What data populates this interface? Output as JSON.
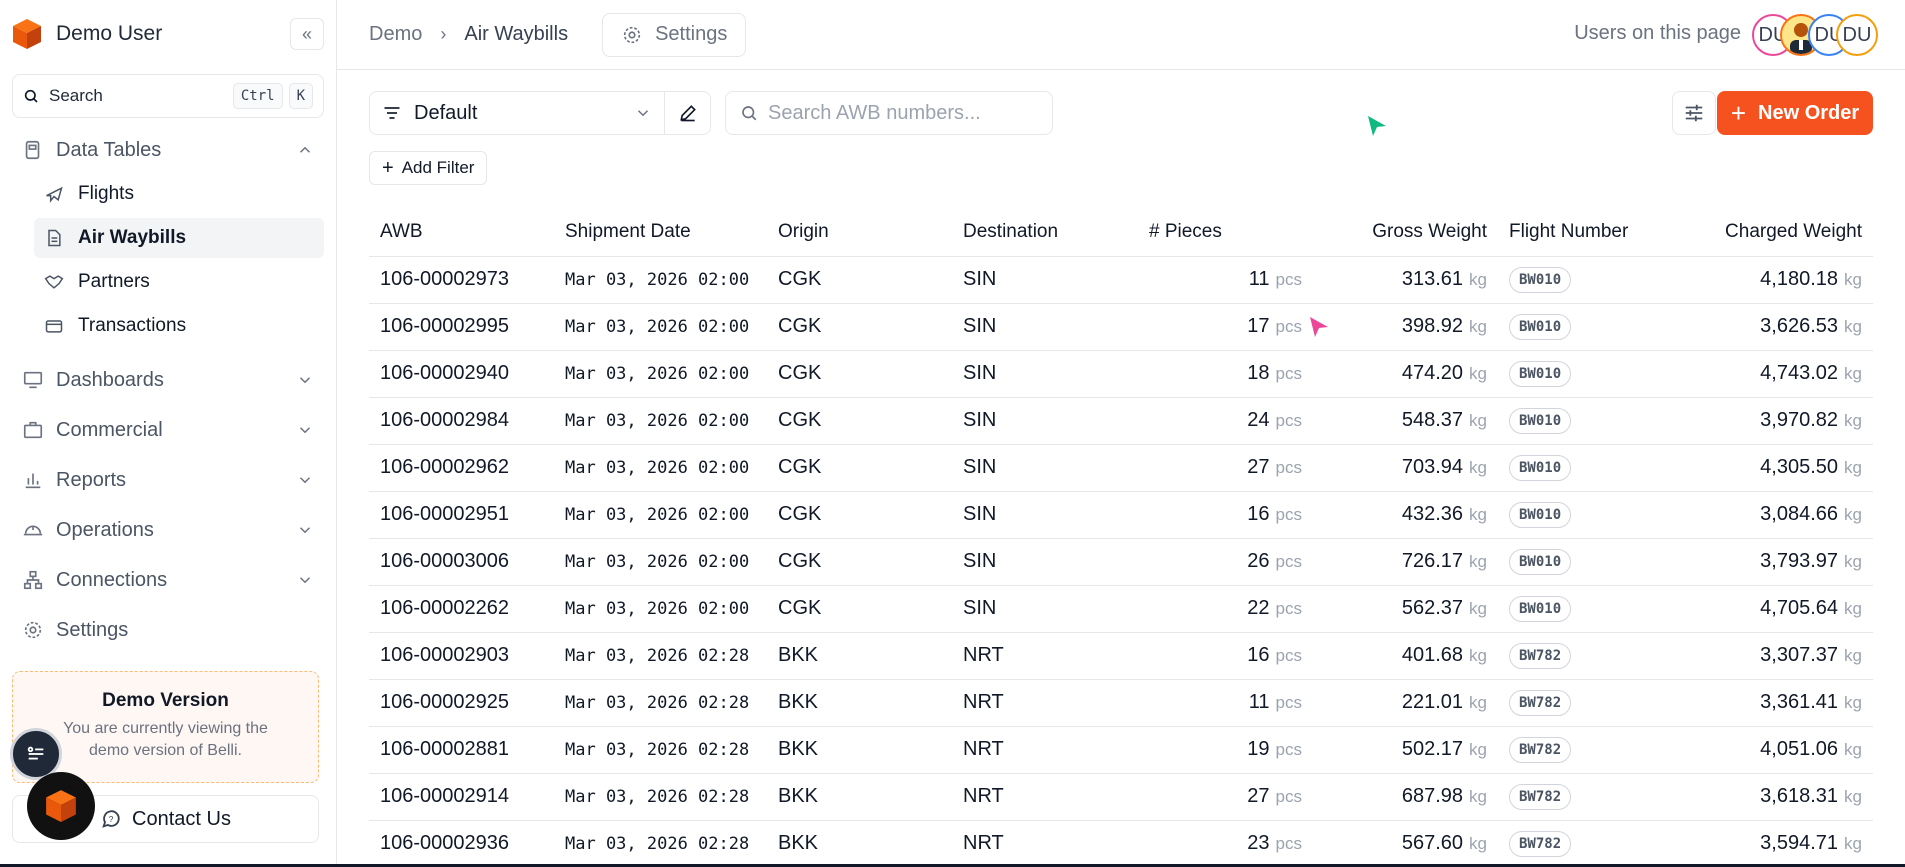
{
  "sidebar": {
    "user_name": "Demo User",
    "search_label": "Search",
    "kbd_ctrl": "Ctrl",
    "kbd_k": "K",
    "data_tables_label": "Data Tables",
    "sub_items": [
      {
        "label": "Flights",
        "icon": "plane-icon"
      },
      {
        "label": "Air Waybills",
        "icon": "document-icon",
        "active": true
      },
      {
        "label": "Partners",
        "icon": "handshake-icon"
      },
      {
        "label": "Transactions",
        "icon": "card-icon"
      }
    ],
    "groups": [
      {
        "label": "Dashboards",
        "icon": "monitor-icon"
      },
      {
        "label": "Commercial",
        "icon": "briefcase-icon"
      },
      {
        "label": "Reports",
        "icon": "bar-chart-icon"
      },
      {
        "label": "Operations",
        "icon": "hardhat-icon"
      },
      {
        "label": "Connections",
        "icon": "network-icon"
      }
    ],
    "settings_label": "Settings",
    "demo_card": {
      "title": "Demo Version",
      "line1": "You are currently viewing the",
      "line2": "demo version of Belli."
    },
    "contact_label": "Contact Us"
  },
  "header": {
    "crumb_root": "Demo",
    "crumb_current": "Air Waybills",
    "settings_label": "Settings",
    "users_label": "Users on this page",
    "avatars": [
      {
        "initials": "DU",
        "color": "#ec4899"
      },
      {
        "initials": "",
        "color": "#f97316"
      },
      {
        "initials": "DU",
        "color": "#3b82f6"
      },
      {
        "initials": "DU",
        "color": "#f59e0b"
      }
    ]
  },
  "toolbar": {
    "view_label": "Default",
    "search_placeholder": "Search AWB numbers...",
    "new_order_label": "New Order",
    "add_filter_label": "Add Filter"
  },
  "table": {
    "columns": [
      "AWB",
      "Shipment Date",
      "Origin",
      "Destination",
      "# Pieces",
      "Gross Weight",
      "Flight Number",
      "Charged Weight"
    ],
    "pieces_unit": "pcs",
    "weight_unit": "kg",
    "rows": [
      {
        "awb": "106-00002973",
        "date": "Mar 03, 2026 02:00",
        "origin": "CGK",
        "dest": "SIN",
        "pieces": "11",
        "gross": "313.61",
        "flight": "BW010",
        "charged": "4,180.18"
      },
      {
        "awb": "106-00002995",
        "date": "Mar 03, 2026 02:00",
        "origin": "CGK",
        "dest": "SIN",
        "pieces": "17",
        "gross": "398.92",
        "flight": "BW010",
        "charged": "3,626.53"
      },
      {
        "awb": "106-00002940",
        "date": "Mar 03, 2026 02:00",
        "origin": "CGK",
        "dest": "SIN",
        "pieces": "18",
        "gross": "474.20",
        "flight": "BW010",
        "charged": "4,743.02"
      },
      {
        "awb": "106-00002984",
        "date": "Mar 03, 2026 02:00",
        "origin": "CGK",
        "dest": "SIN",
        "pieces": "24",
        "gross": "548.37",
        "flight": "BW010",
        "charged": "3,970.82"
      },
      {
        "awb": "106-00002962",
        "date": "Mar 03, 2026 02:00",
        "origin": "CGK",
        "dest": "SIN",
        "pieces": "27",
        "gross": "703.94",
        "flight": "BW010",
        "charged": "4,305.50"
      },
      {
        "awb": "106-00002951",
        "date": "Mar 03, 2026 02:00",
        "origin": "CGK",
        "dest": "SIN",
        "pieces": "16",
        "gross": "432.36",
        "flight": "BW010",
        "charged": "3,084.66"
      },
      {
        "awb": "106-00003006",
        "date": "Mar 03, 2026 02:00",
        "origin": "CGK",
        "dest": "SIN",
        "pieces": "26",
        "gross": "726.17",
        "flight": "BW010",
        "charged": "3,793.97"
      },
      {
        "awb": "106-00002262",
        "date": "Mar 03, 2026 02:00",
        "origin": "CGK",
        "dest": "SIN",
        "pieces": "22",
        "gross": "562.37",
        "flight": "BW010",
        "charged": "4,705.64"
      },
      {
        "awb": "106-00002903",
        "date": "Mar 03, 2026 02:28",
        "origin": "BKK",
        "dest": "NRT",
        "pieces": "16",
        "gross": "401.68",
        "flight": "BW782",
        "charged": "3,307.37"
      },
      {
        "awb": "106-00002925",
        "date": "Mar 03, 2026 02:28",
        "origin": "BKK",
        "dest": "NRT",
        "pieces": "11",
        "gross": "221.01",
        "flight": "BW782",
        "charged": "3,361.41"
      },
      {
        "awb": "106-00002881",
        "date": "Mar 03, 2026 02:28",
        "origin": "BKK",
        "dest": "NRT",
        "pieces": "19",
        "gross": "502.17",
        "flight": "BW782",
        "charged": "4,051.06"
      },
      {
        "awb": "106-00002914",
        "date": "Mar 03, 2026 02:28",
        "origin": "BKK",
        "dest": "NRT",
        "pieces": "27",
        "gross": "687.98",
        "flight": "BW782",
        "charged": "3,618.31"
      },
      {
        "awb": "106-00002936",
        "date": "Mar 03, 2026 02:28",
        "origin": "BKK",
        "dest": "NRT",
        "pieces": "23",
        "gross": "567.60",
        "flight": "BW782",
        "charged": "3,594.71"
      }
    ]
  },
  "colors": {
    "accent": "#f5521f",
    "cursor_green": "#10b981",
    "cursor_pink": "#ec4899"
  }
}
